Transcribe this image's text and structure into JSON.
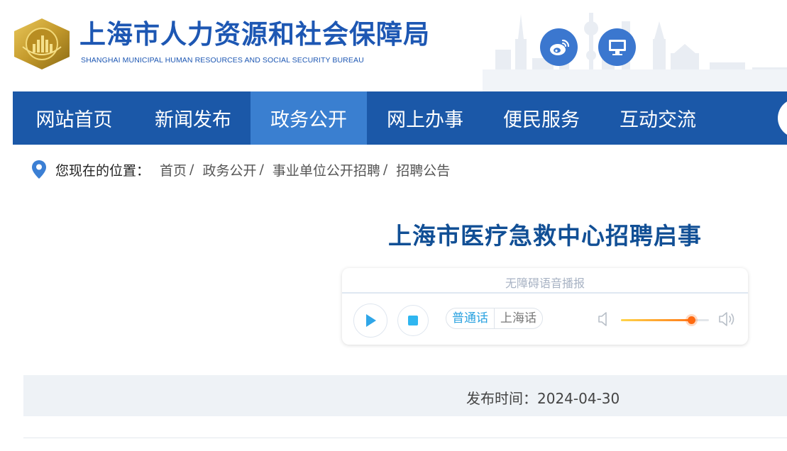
{
  "header": {
    "title": "上海市人力资源和社会保障局",
    "subtitle": "SHANGHAI MUNICIPAL HUMAN RESOURCES AND SOCIAL SECURITY BUREAU",
    "brand_color": "#1d57b3"
  },
  "nav": {
    "items": [
      {
        "label": "网站首页"
      },
      {
        "label": "新闻发布"
      },
      {
        "label": "政务公开",
        "active": true
      },
      {
        "label": "网上办事"
      },
      {
        "label": "便民服务"
      },
      {
        "label": "互动交流"
      }
    ],
    "background": "#1b58a8",
    "active_color": "#3a7fd0"
  },
  "breadcrumb": {
    "label": "您现在的位置：",
    "items": [
      "首页",
      "政务公开",
      "事业单位公开招聘",
      "招聘公告"
    ],
    "separator": "/"
  },
  "article": {
    "title": "上海市医疗急救中心招聘启事",
    "publish_label": "发布时间：",
    "publish_date": "2024-04-30"
  },
  "player": {
    "title": "无障碍语音播报",
    "languages": [
      "普通话",
      "上海话"
    ],
    "selected_language": "普通话",
    "volume": 0.8
  }
}
